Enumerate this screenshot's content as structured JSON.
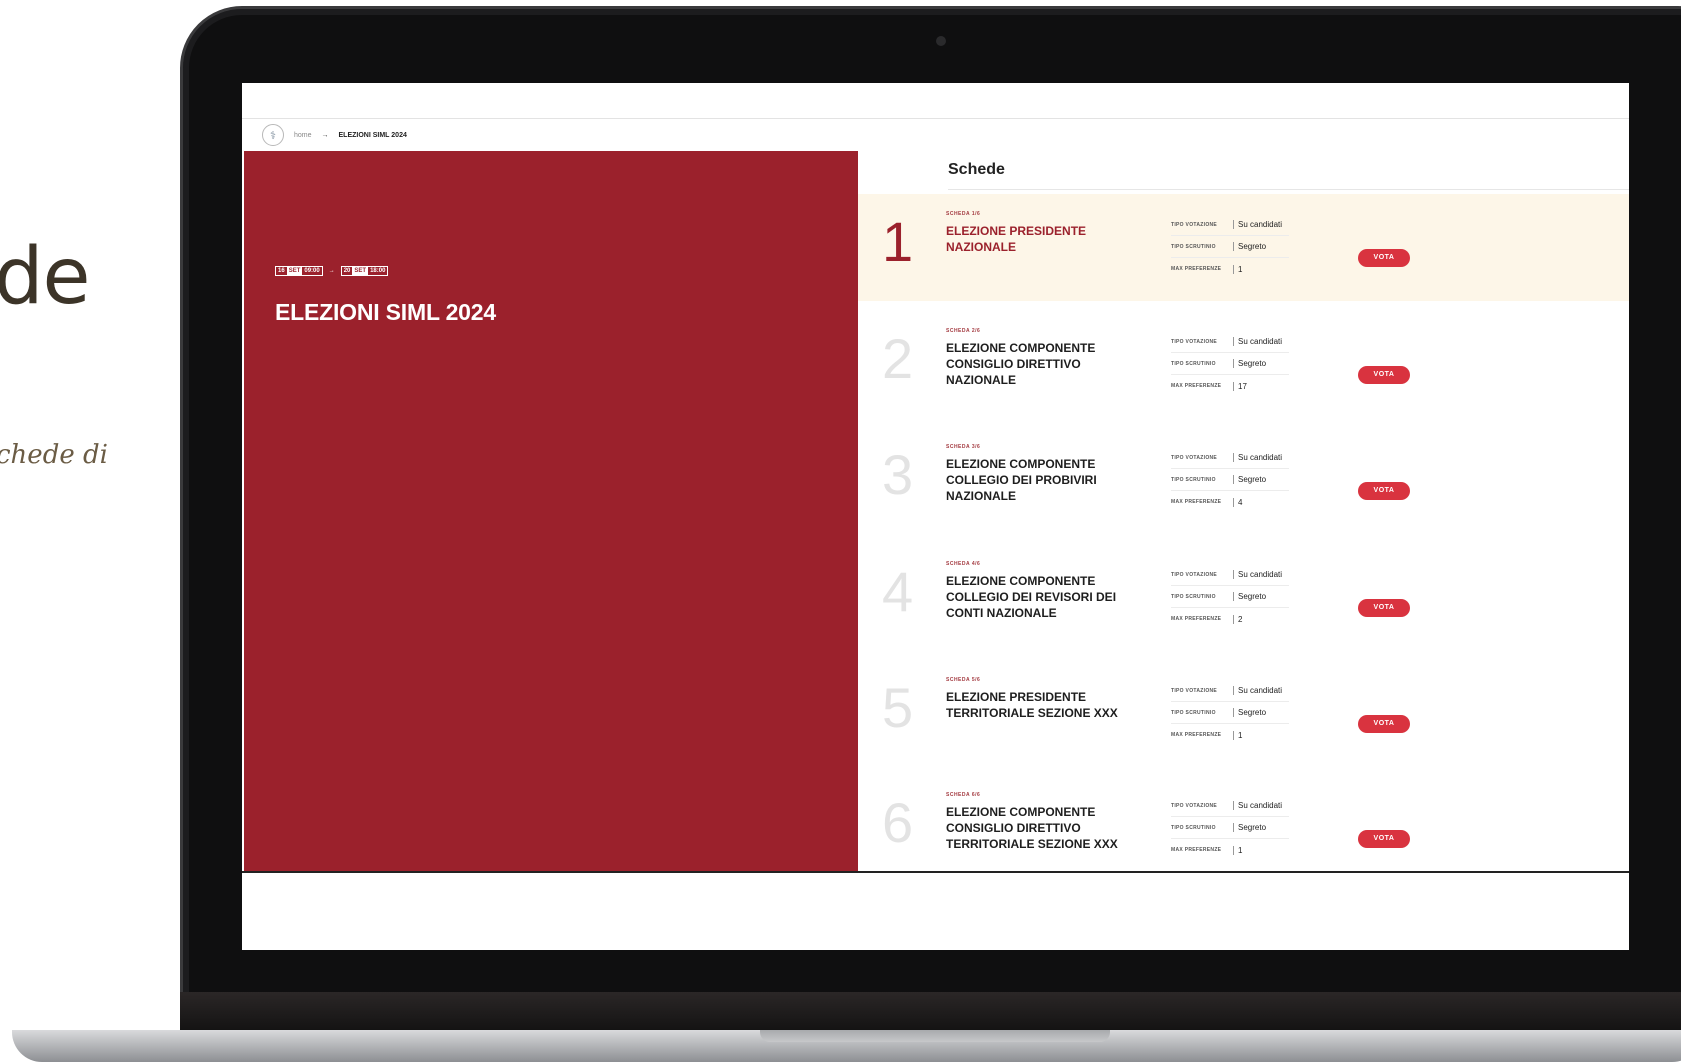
{
  "background_slide": {
    "title_fragment": "de",
    "subtitle_fragment": "chede di"
  },
  "breadcrumb": {
    "home": "home",
    "arrow": "→",
    "current": "ELEZIONI SIML 2024"
  },
  "event": {
    "start_day": "16",
    "start_month": "SET",
    "start_time": "09:00",
    "end_day": "20",
    "end_month": "SET",
    "end_time": "18:00",
    "arrow": "→",
    "title": "ELEZIONI SIML 2024",
    "panel_color": "#9b212c"
  },
  "schede": {
    "heading": "Schede",
    "labels": {
      "tipo_votazione": "TIPO VOTAZIONE",
      "tipo_scrutinio": "TIPO SCRUTINIO",
      "max_preferenze": "MAX PREFERENZE",
      "vota": "VOTA"
    },
    "items": [
      {
        "number": "1",
        "kicker": "SCHEDA 1/6",
        "title": "ELEZIONE PRESIDENTE NAZIONALE",
        "tipo_votazione": "Su candidati",
        "tipo_scrutinio": "Segreto",
        "max_preferenze": "1",
        "active": true
      },
      {
        "number": "2",
        "kicker": "SCHEDA 2/6",
        "title": "ELEZIONE COMPONENTE CONSIGLIO DIRETTIVO NAZIONALE",
        "tipo_votazione": "Su candidati",
        "tipo_scrutinio": "Segreto",
        "max_preferenze": "17",
        "active": false
      },
      {
        "number": "3",
        "kicker": "SCHEDA 3/6",
        "title": "ELEZIONE COMPONENTE COLLEGIO DEI PROBIVIRI NAZIONALE",
        "tipo_votazione": "Su candidati",
        "tipo_scrutinio": "Segreto",
        "max_preferenze": "4",
        "active": false
      },
      {
        "number": "4",
        "kicker": "SCHEDA 4/6",
        "title": "ELEZIONE COMPONENTE COLLEGIO DEI REVISORI DEI CONTI NAZIONALE",
        "tipo_votazione": "Su candidati",
        "tipo_scrutinio": "Segreto",
        "max_preferenze": "2",
        "active": false
      },
      {
        "number": "5",
        "kicker": "SCHEDA 5/6",
        "title": "ELEZIONE PRESIDENTE TERRITORIALE SEZIONE XXX",
        "tipo_votazione": "Su candidati",
        "tipo_scrutinio": "Segreto",
        "max_preferenze": "1",
        "active": false
      },
      {
        "number": "6",
        "kicker": "SCHEDA 6/6",
        "title": "ELEZIONE COMPONENTE CONSIGLIO DIRETTIVO TERRITORIALE SEZIONE XXX",
        "tipo_votazione": "Su candidati",
        "tipo_scrutinio": "Segreto",
        "max_preferenze": "1",
        "active": false
      }
    ]
  },
  "colors": {
    "brand_red": "#9b212c",
    "button_red": "#d9333f",
    "active_row_bg": "#fdf6e8"
  }
}
